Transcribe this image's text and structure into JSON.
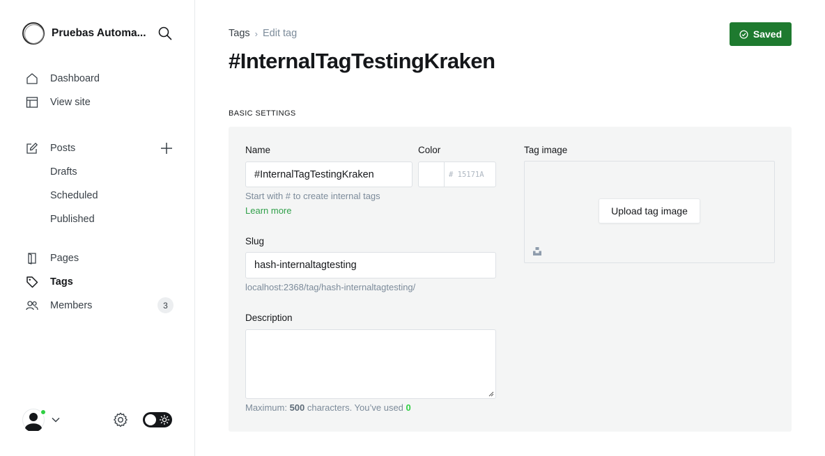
{
  "sidebar": {
    "site_name": "Pruebas Automa...",
    "nav": {
      "dashboard": "Dashboard",
      "view_site": "View site",
      "posts": "Posts",
      "drafts": "Drafts",
      "scheduled": "Scheduled",
      "published": "Published",
      "pages": "Pages",
      "tags": "Tags",
      "members": "Members",
      "members_count": "3"
    }
  },
  "header": {
    "breadcrumb_parent": "Tags",
    "breadcrumb_separator": "›",
    "breadcrumb_current": "Edit tag",
    "title": "#InternalTagTestingKraken",
    "saved_label": "Saved"
  },
  "form": {
    "section_label": "BASIC SETTINGS",
    "name_label": "Name",
    "name_value": "#InternalTagTestingKraken",
    "name_hint": "Start with # to create internal tags",
    "learn_more": "Learn more",
    "color_label": "Color",
    "color_placeholder": "# 15171A",
    "slug_label": "Slug",
    "slug_value": "hash-internaltagtesting",
    "slug_url": "localhost:2368/tag/hash-internaltagtesting/",
    "description_label": "Description",
    "char_prefix": "Maximum: ",
    "char_max": "500",
    "char_middle": " characters. You’ve used ",
    "char_used": "0",
    "tag_image_label": "Tag image",
    "upload_label": "Upload tag image"
  },
  "colors": {
    "accent_green": "#1e7a2f",
    "link_green": "#30a04a",
    "online_dot": "#30cf43",
    "panel_bg": "#f4f5f5"
  }
}
